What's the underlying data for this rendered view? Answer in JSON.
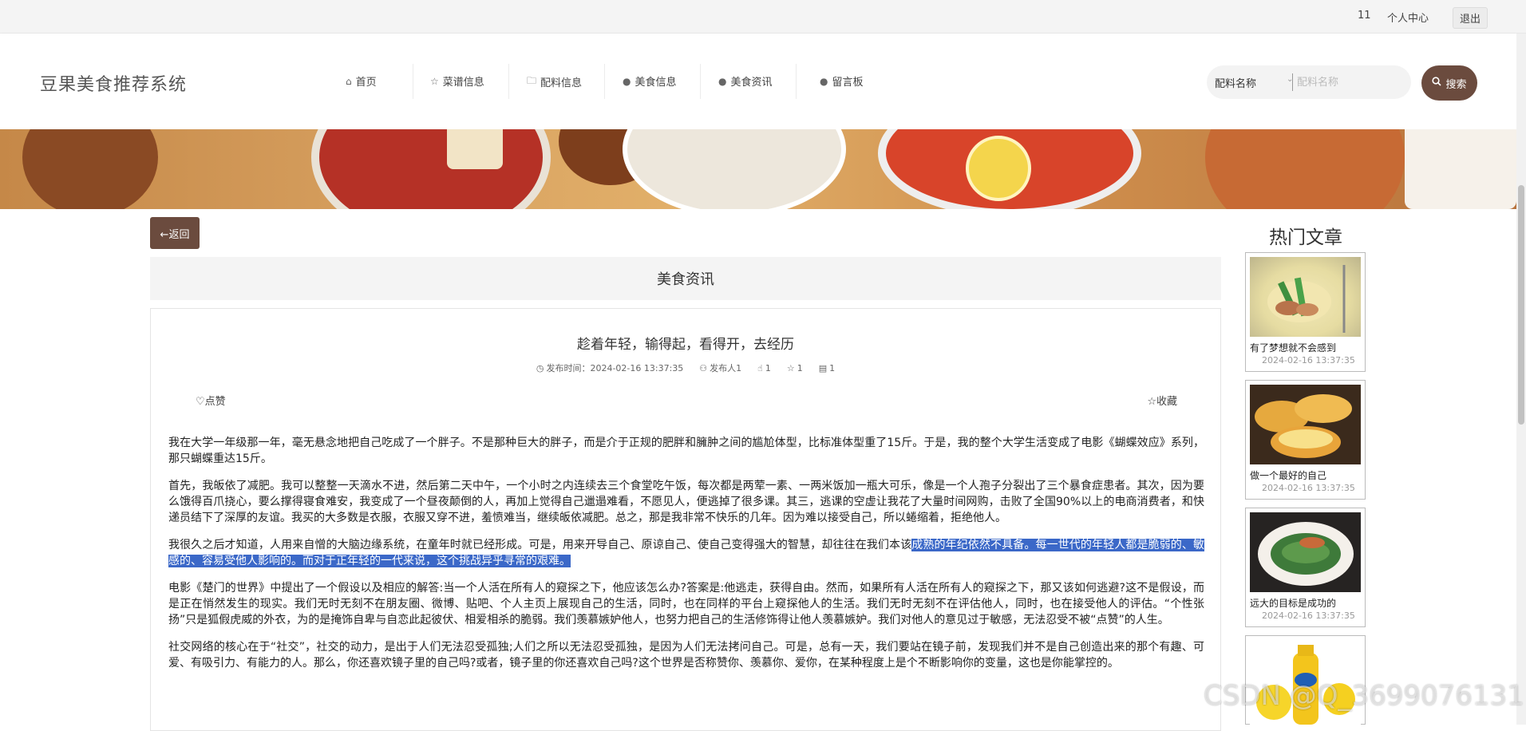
{
  "topbar": {
    "user": "11",
    "profile": "个人中心",
    "logout": "退出"
  },
  "header": {
    "logo": "豆果美食推荐系统",
    "nav": [
      {
        "label": "首页",
        "icon": "⌂"
      },
      {
        "label": "菜谱信息",
        "icon": "☆"
      },
      {
        "label": "配料信息",
        "icon": "🗀"
      },
      {
        "label": "美食信息",
        "icon": "●"
      },
      {
        "label": "美食资讯",
        "icon": "●"
      },
      {
        "label": "留言板",
        "icon": "●"
      }
    ],
    "search": {
      "select_value": "配料名称",
      "placeholder": "配料名称",
      "button": "搜索"
    }
  },
  "back_label": "←返回",
  "section_title": "美食资讯",
  "article": {
    "title": "趁着年轻，输得起，看得开，去经历",
    "published": "发布时间：2024-02-16 13:37:35",
    "author": "发布人1",
    "likes": "1",
    "favorites": "1",
    "comments": "1",
    "like_label": "点赞",
    "fav_label": "收藏",
    "p1": "我在大学一年级那一年，毫无悬念地把自己吃成了一个胖子。不是那种巨大的胖子，而是介于正规的肥胖和臃肿之间的尴尬体型，比标准体型重了15斤。于是，我的整个大学生活变成了电影《蝴蝶效应》系列，那只蝴蝶重达15斤。",
    "p2": "首先，我皈依了减肥。我可以整整一天滴水不进，然后第二天中午，一个小时之内连续去三个食堂吃午饭，每次都是两荤一素、一两米饭加一瓶大可乐，像是一个人孢子分裂出了三个暴食症患者。其次，因为要么饿得百爪挠心，要么撑得寝食难安，我变成了一个昼夜颠倒的人，再加上觉得自己邋遢难看，不愿见人，便逃掉了很多课。其三，逃课的空虚让我花了大量时间网购，击败了全国90%以上的电商消费者，和快递员结下了深厚的友谊。我买的大多数是衣服，衣服又穿不进，羞愤难当，继续皈依减肥。总之，那是我非常不快乐的几年。因为难以接受自己，所以蜷缩着，拒绝他人。",
    "p3_a": "我很久之后才知道，人用来自憎的大脑边缘系统，在童年时就已经形成。可是，用来开导自己、原谅自己、使自己变得强大的智慧，却往往在我们本该",
    "p3_b": "成熟的年纪依然不具备。每一世代的年轻人都是脆弱的、敏感的、容易受他人影响的。而对于正年轻的一代来说，这个挑战异乎寻常的艰难。",
    "p4": "电影《楚门的世界》中提出了一个假设以及相应的解答:当一个人活在所有人的窥探之下，他应该怎么办?答案是:他逃走，获得自由。然而，如果所有人活在所有人的窥探之下，那又该如何逃避?这不是假设，而是正在悄然发生的现实。我们无时无刻不在朋友圈、微博、贴吧、个人主页上展现自己的生活，同时，也在同样的平台上窥探他人的生活。我们无时无刻不在评估他人，同时，也在接受他人的评估。“个性张扬”只是狐假虎威的外衣，为的是掩饰自卑与自恋此起彼伏、相爱相杀的脆弱。我们羡慕嫉妒他人，也努力把自己的生活修饰得让他人羡慕嫉妒。我们对他人的意见过于敏感，无法忍受不被“点赞”的人生。",
    "p5": "社交网络的核心在于“社交”，社交的动力，是出于人们无法忍受孤独;人们之所以无法忍受孤独，是因为人们无法拷问自己。可是，总有一天，我们要站在镜子前，发现我们并不是自己创造出来的那个有趣、可爱、有吸引力、有能力的人。那么，你还喜欢镜子里的自己吗?或者，镜子里的你还喜欢自己吗?这个世界是否称赞你、羡慕你、爱你，在某种程度上是个不断影响你的变量，这也是你能掌控的。"
  },
  "hot": {
    "title": "热门文章",
    "items": [
      {
        "name": "有了梦想就不会感到",
        "date": "2024-02-16 13:37:35"
      },
      {
        "name": "做一个最好的自己",
        "date": "2024-02-16 13:37:35"
      },
      {
        "name": "远大的目标是成功的",
        "date": "2024-02-16 13:37:35"
      }
    ]
  },
  "watermark": "CSDN @Q_3699076131"
}
